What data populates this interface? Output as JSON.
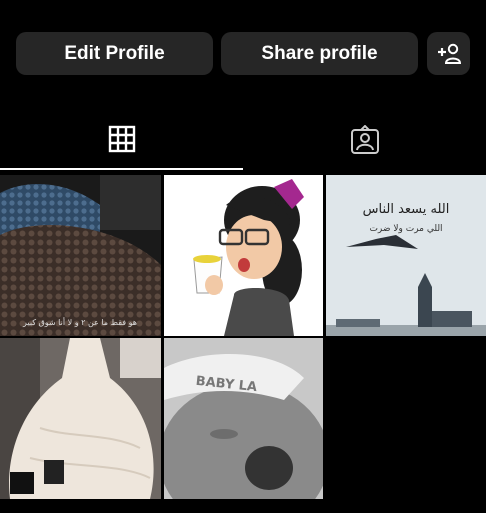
{
  "actions": {
    "edit_profile": "Edit Profile",
    "share_profile": "Share profile",
    "add_person_icon": "add-person-icon"
  },
  "tabs": [
    {
      "name": "posts-grid",
      "icon": "grid-icon",
      "active": true
    },
    {
      "name": "tagged",
      "icon": "tagged-person-icon",
      "active": false
    }
  ],
  "posts": [
    {
      "type": "photo",
      "caption": "هو فقط ما عن ٢ و لا أنا شوق كبير"
    },
    {
      "type": "photo"
    },
    {
      "type": "photo",
      "title": "الله يسعد الناس",
      "subtitle": "اللي مرت ولا ضرت"
    },
    {
      "type": "photo"
    },
    {
      "type": "photo",
      "text": "BABY LA"
    }
  ],
  "colors": {
    "background": "#000000",
    "button": "#262626",
    "accent": "#ffffff"
  }
}
